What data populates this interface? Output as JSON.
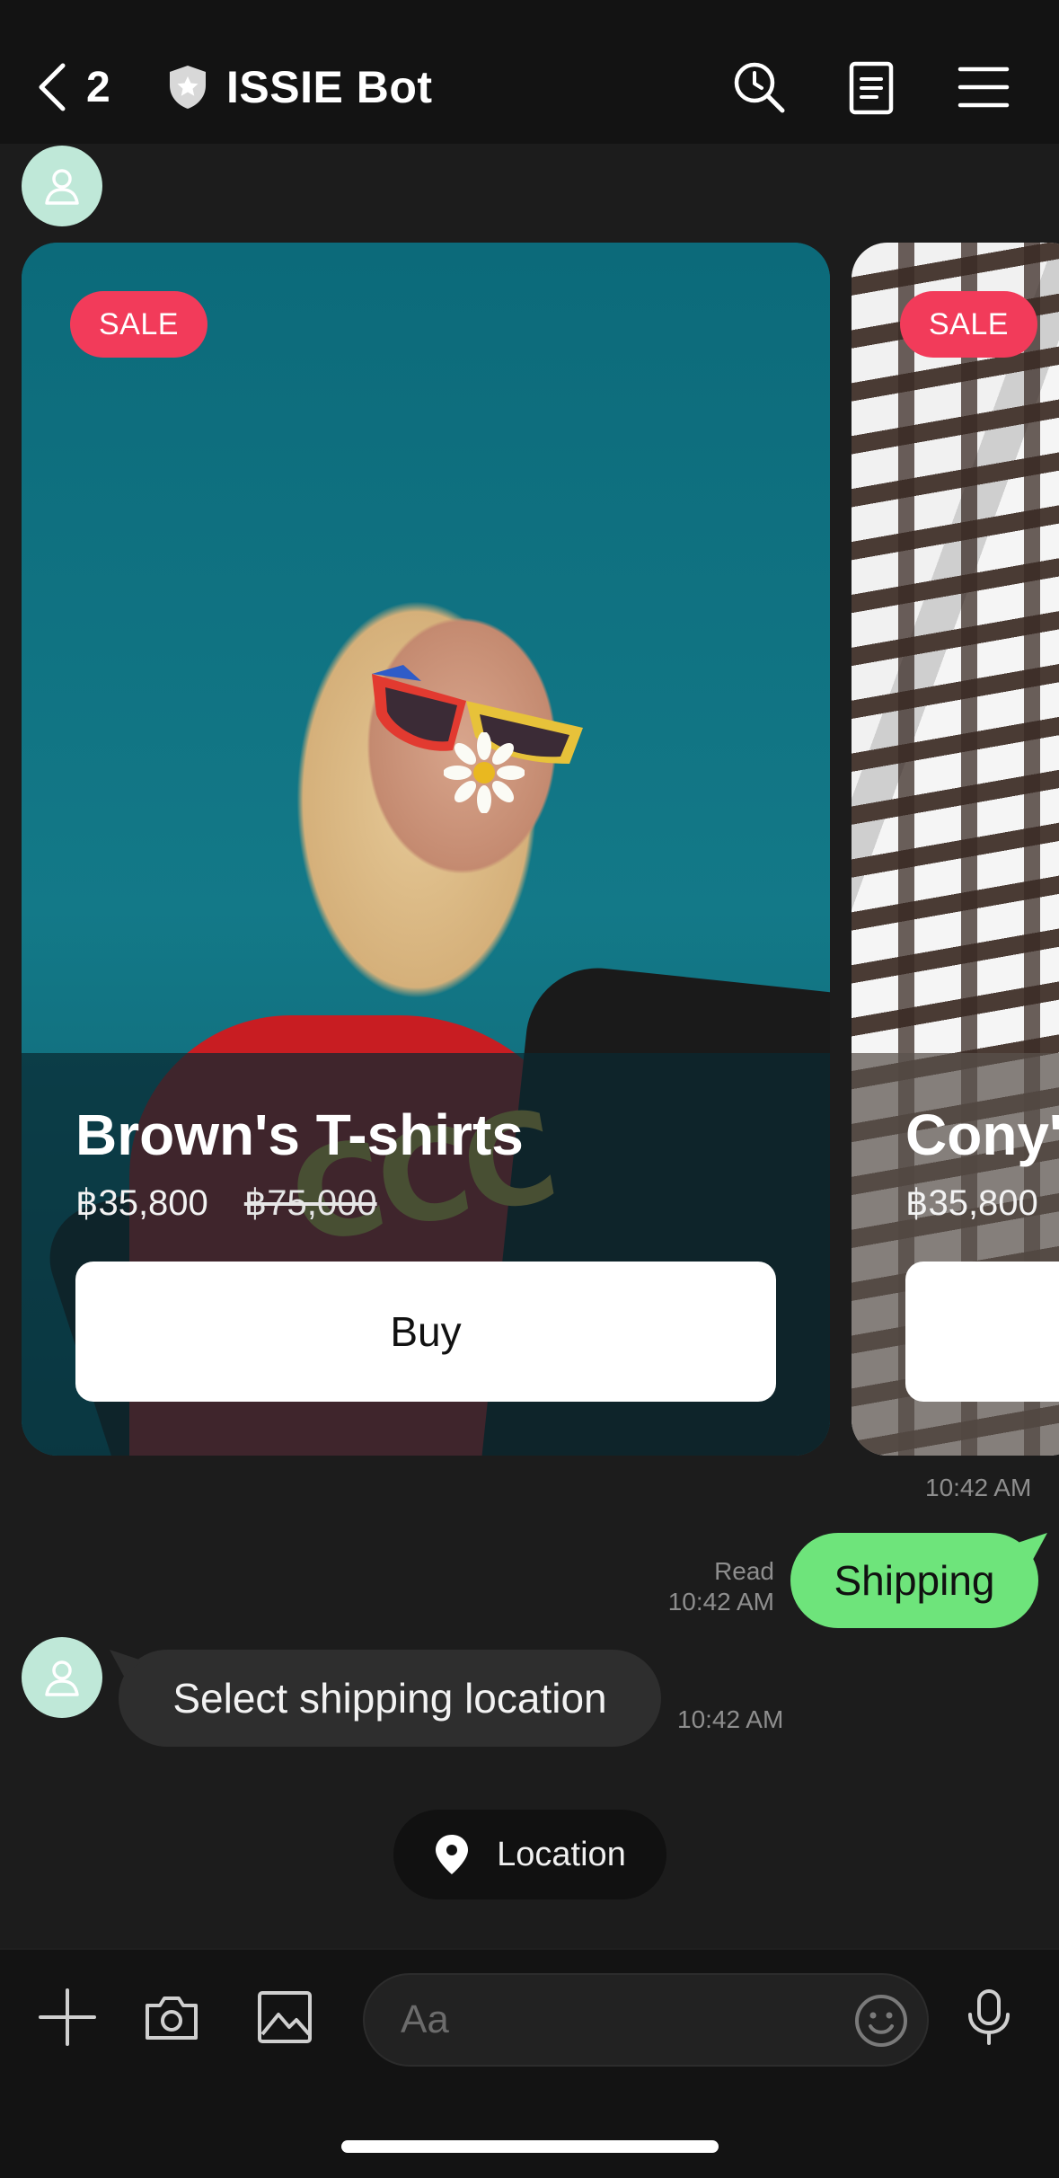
{
  "header": {
    "back_count": "2",
    "title": "ISSIE Bot",
    "icons": [
      "back-chevron-icon",
      "verified-shield-icon",
      "search-clock-icon",
      "notes-icon",
      "menu-icon"
    ]
  },
  "carousel": {
    "cards": [
      {
        "badge": "SALE",
        "name": "Brown's T-shirts",
        "price": "฿35,800",
        "old_price": "฿75,000",
        "button": "Buy"
      },
      {
        "badge": "SALE",
        "name": "Cony'",
        "price": "฿35,800"
      }
    ],
    "time": "10:42 AM"
  },
  "messages": {
    "outgoing": {
      "text": "Shipping",
      "status": "Read",
      "time": "10:42 AM"
    },
    "incoming": {
      "text": "Select shipping location",
      "time": "10:42 AM"
    }
  },
  "quick_reply": {
    "label": "Location"
  },
  "input_bar": {
    "placeholder": "Aa",
    "icons": [
      "plus-icon",
      "camera-icon",
      "image-icon",
      "emoji-icon",
      "microphone-icon"
    ]
  },
  "colors": {
    "accent_green": "#6ee47b",
    "sale_red": "#f23b5a",
    "avatar_mint": "#bfe8d8",
    "background": "#1c1c1c"
  }
}
